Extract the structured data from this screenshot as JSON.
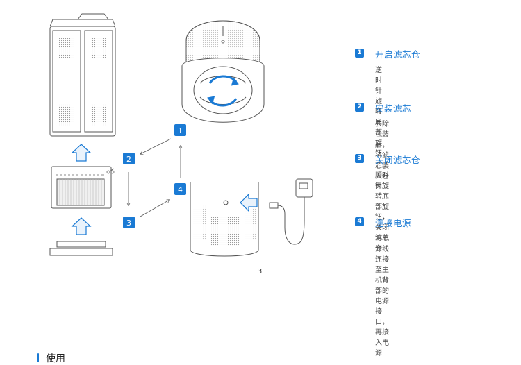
{
  "colors": {
    "accent": "#1a7ad4",
    "line": "#555555",
    "bg": "#ffffff"
  },
  "diagram": {
    "markers": [
      "1",
      "2",
      "3",
      "4"
    ],
    "icons": [
      "rotate-arrows-icon",
      "up-arrow-icon",
      "left-arrow-icon",
      "power-adapter-icon"
    ]
  },
  "steps": [
    {
      "number": "1",
      "title": "开启滤芯仓",
      "description": "逆时针旋转底部旋钮"
    },
    {
      "number": "2",
      "title": "安装滤芯",
      "description": "去除包装后，将滤芯装入仓内"
    },
    {
      "number": "3",
      "title": "关闭滤芯仓",
      "description": "顺时针旋转底部旋钮，\n关闭滤芯仓"
    },
    {
      "number": "4",
      "title": "连接电源",
      "description": "将电源线连接至主机背部的\n电源接口，再接入电源"
    }
  ],
  "page": {
    "number": "3"
  },
  "section": {
    "title": "使用"
  }
}
